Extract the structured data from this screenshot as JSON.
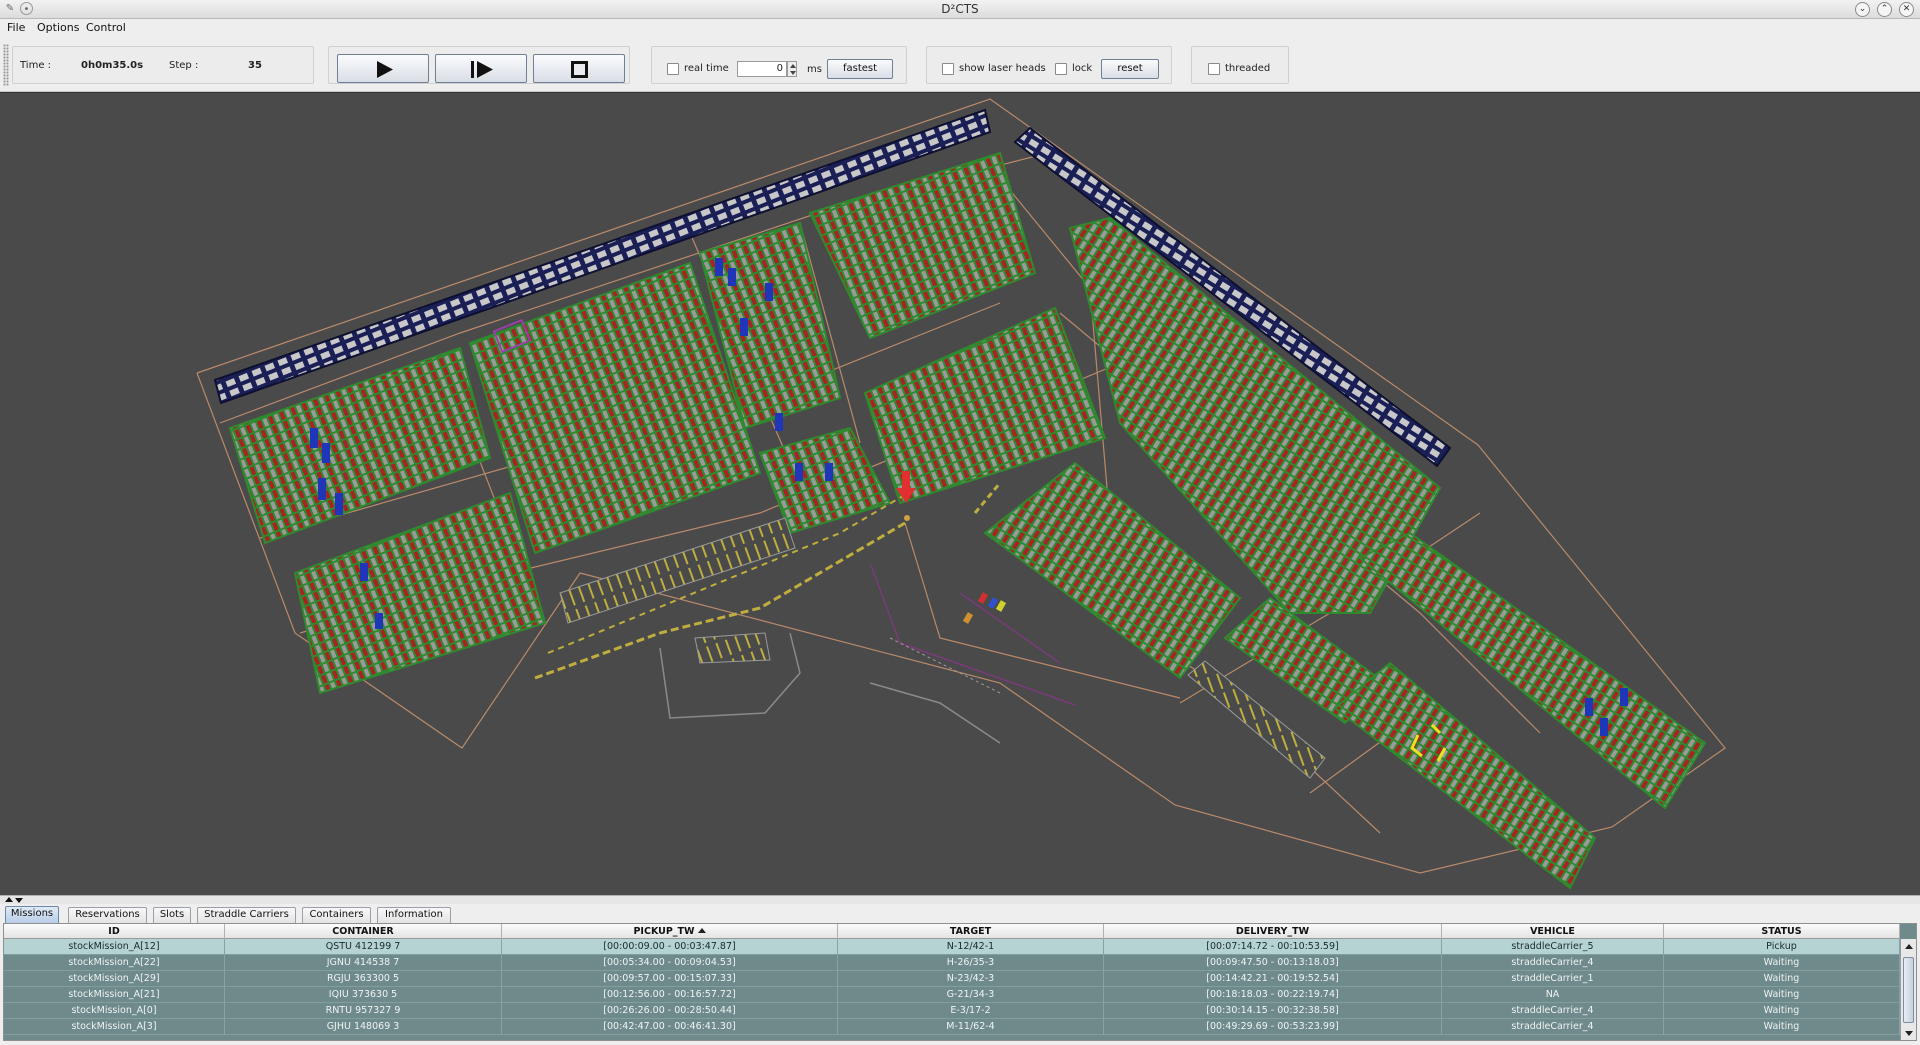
{
  "window": {
    "title": "D²CTS"
  },
  "menu": [
    {
      "label": "File",
      "mnemonic": "F"
    },
    {
      "label": "Options",
      "mnemonic": "O"
    },
    {
      "label": "Control",
      "mnemonic": "C"
    }
  ],
  "toolbar": {
    "time_label": "Time :",
    "time_value": "0h0m35.0s",
    "step_label": "Step :",
    "step_value": "35",
    "real_time_label": "real time",
    "delay_value": "0",
    "ms_label": "ms",
    "fastest_label": "fastest",
    "show_laser_heads_label": "show laser heads",
    "lock_label": "lock",
    "reset_label": "reset",
    "threaded_label": "threaded"
  },
  "tabs": [
    "Missions",
    "Reservations",
    "Slots",
    "Straddle Carriers",
    "Containers",
    "Information"
  ],
  "active_tab": "Missions",
  "table": {
    "columns": [
      "ID",
      "CONTAINER",
      "PICKUP_TW",
      "TARGET",
      "DELIVERY_TW",
      "VEHICLE",
      "STATUS"
    ],
    "sorted_column": "PICKUP_TW",
    "rows": [
      [
        "stockMission_A[12]",
        "QSTU 412199 7",
        "[00:00:09.00 - 00:03:47.87]",
        "N-12/42-1",
        "[00:07:14.72 - 00:10:53.59]",
        "straddleCarrier_5",
        "Pickup"
      ],
      [
        "stockMission_A[22]",
        "JGNU 414538 7",
        "[00:05:34.00 - 00:09:04.53]",
        "H-26/35-3",
        "[00:09:47.50 - 00:13:18.03]",
        "straddleCarrier_4",
        "Waiting"
      ],
      [
        "stockMission_A[29]",
        "RGJU 363300 5",
        "[00:09:57.00 - 00:15:07.33]",
        "N-23/42-3",
        "[00:14:42.21 - 00:19:52.54]",
        "straddleCarrier_1",
        "Waiting"
      ],
      [
        "stockMission_A[21]",
        "IQIU 373630 5",
        "[00:12:56.00 - 00:16:57.72]",
        "G-21/34-3",
        "[00:18:18.03 - 00:22:19.74]",
        "NA",
        "Waiting"
      ],
      [
        "stockMission_A[0]",
        "RNTU 957327 9",
        "[00:26:26.00 - 00:28:50.44]",
        "E-3/17-2",
        "[00:30:14.15 - 00:32:38.58]",
        "straddleCarrier_4",
        "Waiting"
      ],
      [
        "stockMission_A[3]",
        "GJHU 148069 3",
        "[00:42:47.00 - 00:46:41.30]",
        "M-11/62-4",
        "[00:49:29.69 - 00:53:23.99]",
        "straddleCarrier_4",
        "Waiting"
      ]
    ],
    "selected_row": 0
  },
  "colors": {
    "canvas_bg": "#4a4a4a",
    "container_red": "#a82424",
    "container_green": "#2f8a2f",
    "container_grey": "#9a9a9a",
    "container_blue": "#2036b8",
    "quay_navy": "#1a1f55",
    "road_orange": "#b98a6a",
    "table_row": "#6e8a8a",
    "table_selected": "#b6d3d3"
  }
}
